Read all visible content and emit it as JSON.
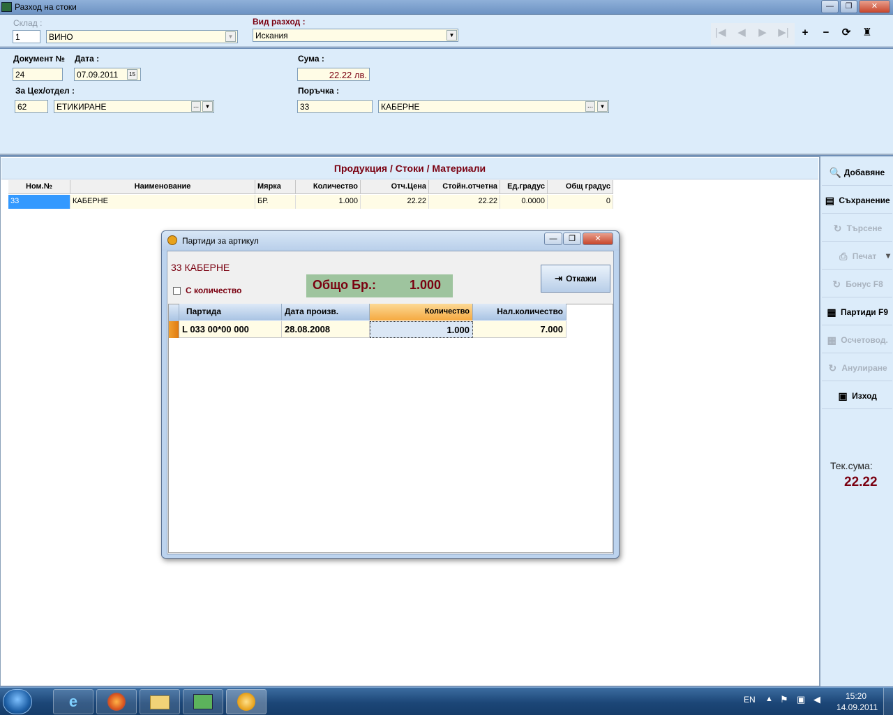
{
  "window": {
    "title": "Разход на стоки",
    "minimize": "—",
    "maximize": "❐",
    "close": "✕"
  },
  "top": {
    "warehouse_label": "Склад :",
    "warehouse_code": "1",
    "warehouse_name": "ВИНО",
    "expense_type_label": "Вид разход :",
    "expense_type_value": "Искания",
    "nav": {
      "first": "|◀",
      "prev": "◀",
      "next": "▶",
      "last": "▶|",
      "add": "+",
      "remove": "−",
      "refresh": "⟳",
      "settings": "♜"
    }
  },
  "doc": {
    "doc_no_label": "Документ №",
    "doc_no": "24",
    "date_label": "Дата :",
    "date": "07.09.2011",
    "calendar_btn": "15",
    "sum_label": "Сума :",
    "sum": "22.22 лв.",
    "dept_label": "За Цех/отдел :",
    "dept_code": "62",
    "dept_name": "ЕТИКИРАНЕ",
    "order_label": "Поръчка :",
    "order_code": "33",
    "order_name": "КАБЕРНЕ",
    "ellipsis": "...",
    "dropdown": "▼"
  },
  "grid": {
    "title": "Продукция / Стоки / Материали",
    "columns": [
      "Ном.№",
      "Наименование",
      "Мярка",
      "Количество",
      "Отч.Цена",
      "Стойн.отчетна",
      "Ед.градус",
      "Общ градус"
    ],
    "rows": [
      [
        "33",
        "КАБЕРНЕ",
        "БР.",
        "1.000",
        "22.22",
        "22.22",
        "0.0000",
        "0"
      ]
    ]
  },
  "sidebar": {
    "buttons": [
      {
        "label": "Добавяне",
        "icon": "🔍",
        "enabled": true
      },
      {
        "label": "Съхранение",
        "icon": "▤",
        "enabled": true
      },
      {
        "label": "Търсене",
        "icon": "↻",
        "enabled": false
      },
      {
        "label": "Печат",
        "icon": "⎙",
        "enabled": false
      },
      {
        "label": "Бонус F8",
        "icon": "↻",
        "enabled": false
      },
      {
        "label": "Партиди F9",
        "icon": "▦",
        "enabled": true
      },
      {
        "label": "Осчетовод.",
        "icon": "▦",
        "enabled": false
      },
      {
        "label": "Анулиране",
        "icon": "↻",
        "enabled": false
      },
      {
        "label": "Изход",
        "icon": "▣",
        "enabled": true
      }
    ],
    "print_arrow": "▾",
    "current_sum_label": "Тек.сума:",
    "current_sum": "22.22"
  },
  "dialog": {
    "title": "Партиди за артикул",
    "item": "33 КАБЕРНЕ",
    "with_qty_label": "С количество",
    "total_label": "Общо Бр.:",
    "total_value": "1.000",
    "cancel_label": "Откажи",
    "columns": [
      "Партида",
      "Дата произв.",
      "Количество",
      "Нал.количество"
    ],
    "rows": [
      [
        "L  033  00*00 000",
        "28.08.2008",
        "1.000",
        "7.000"
      ]
    ]
  },
  "taskbar": {
    "lang": "EN",
    "time": "15:20",
    "date": "14.09.2011"
  }
}
